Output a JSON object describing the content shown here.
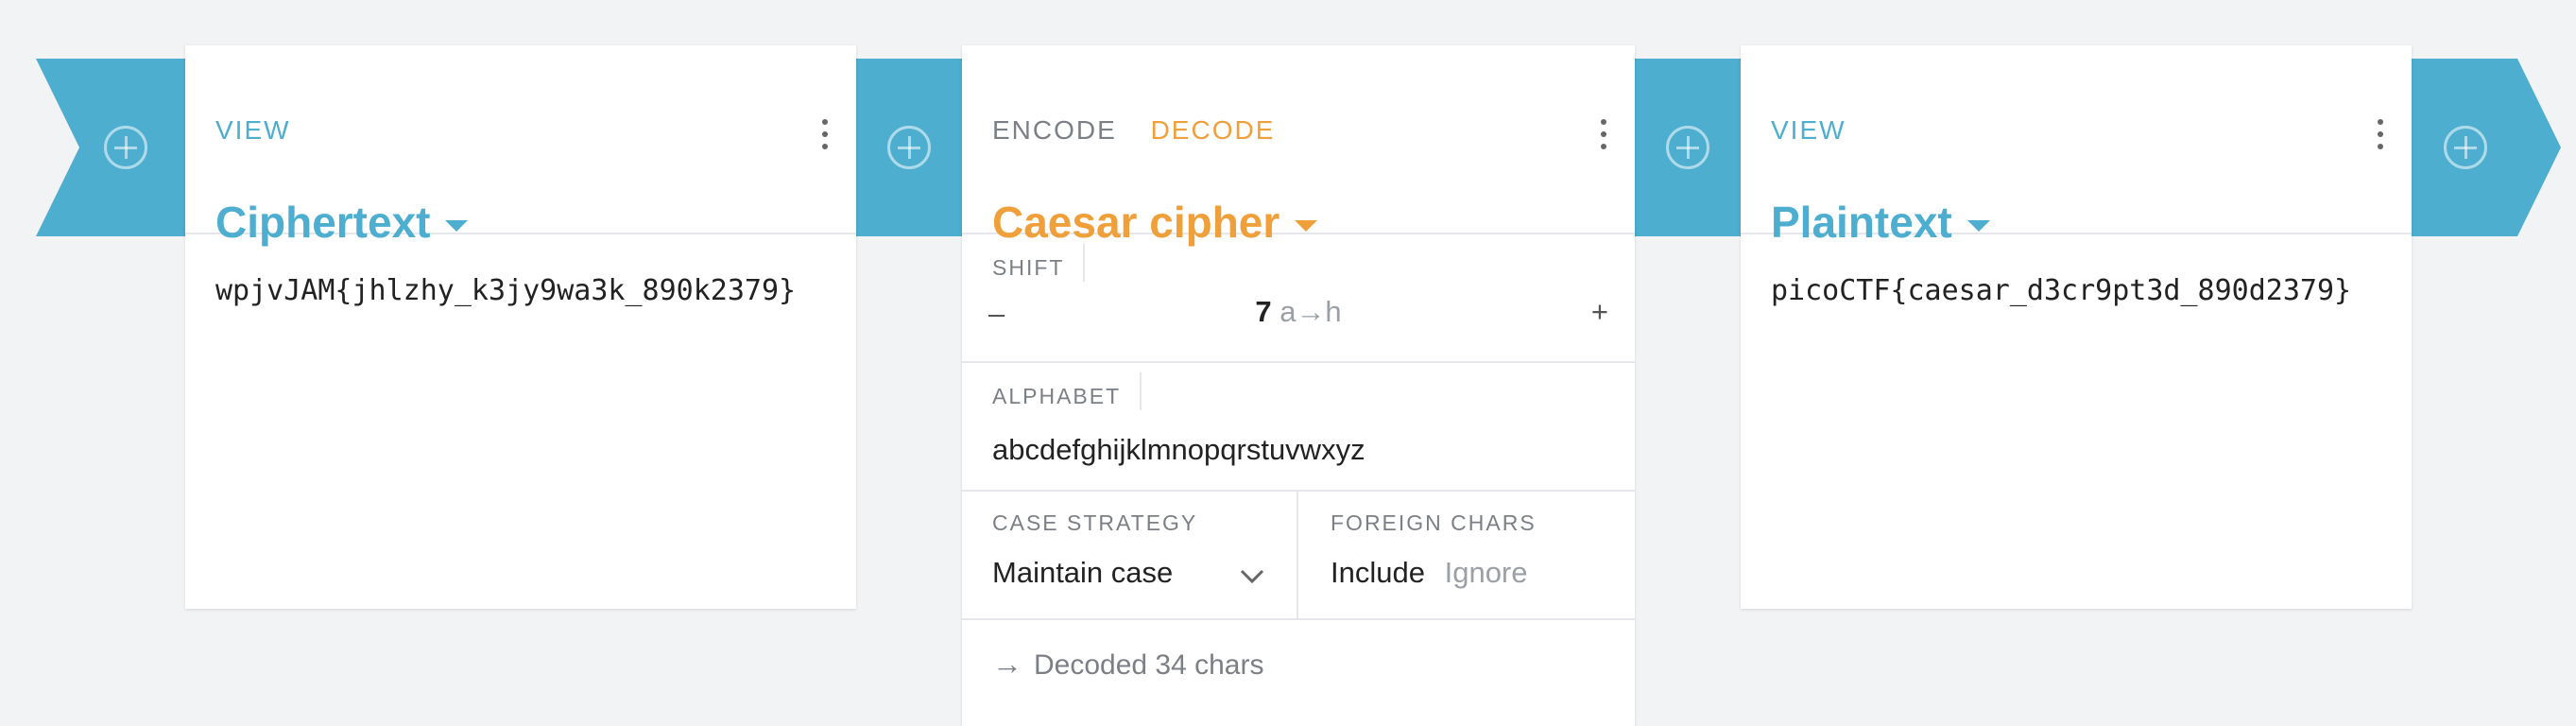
{
  "colors": {
    "accent": "#4eaed0",
    "decode": "#f0a03a",
    "background": "#f2f3f5"
  },
  "view1": {
    "tab": "VIEW",
    "title": "Ciphertext",
    "content": "wpjvJAM{jhlzhy_k3jy9wa3k_890k2379}"
  },
  "operation": {
    "tab_encode": "ENCODE",
    "tab_decode": "DECODE",
    "title": "Caesar cipher",
    "shift": {
      "label": "SHIFT",
      "minus": "–",
      "value": "7",
      "mapping": "a→h",
      "plus": "+"
    },
    "alphabet": {
      "label": "ALPHABET",
      "value": "abcdefghijklmnopqrstuvwxyz"
    },
    "case_strategy": {
      "label": "CASE STRATEGY",
      "value": "Maintain case"
    },
    "foreign_chars": {
      "label": "FOREIGN CHARS",
      "include": "Include",
      "ignore": "Ignore"
    },
    "status": "Decoded 34 chars"
  },
  "view2": {
    "tab": "VIEW",
    "title": "Plaintext",
    "content": "picoCTF{caesar_d3cr9pt3d_890d2379}"
  }
}
